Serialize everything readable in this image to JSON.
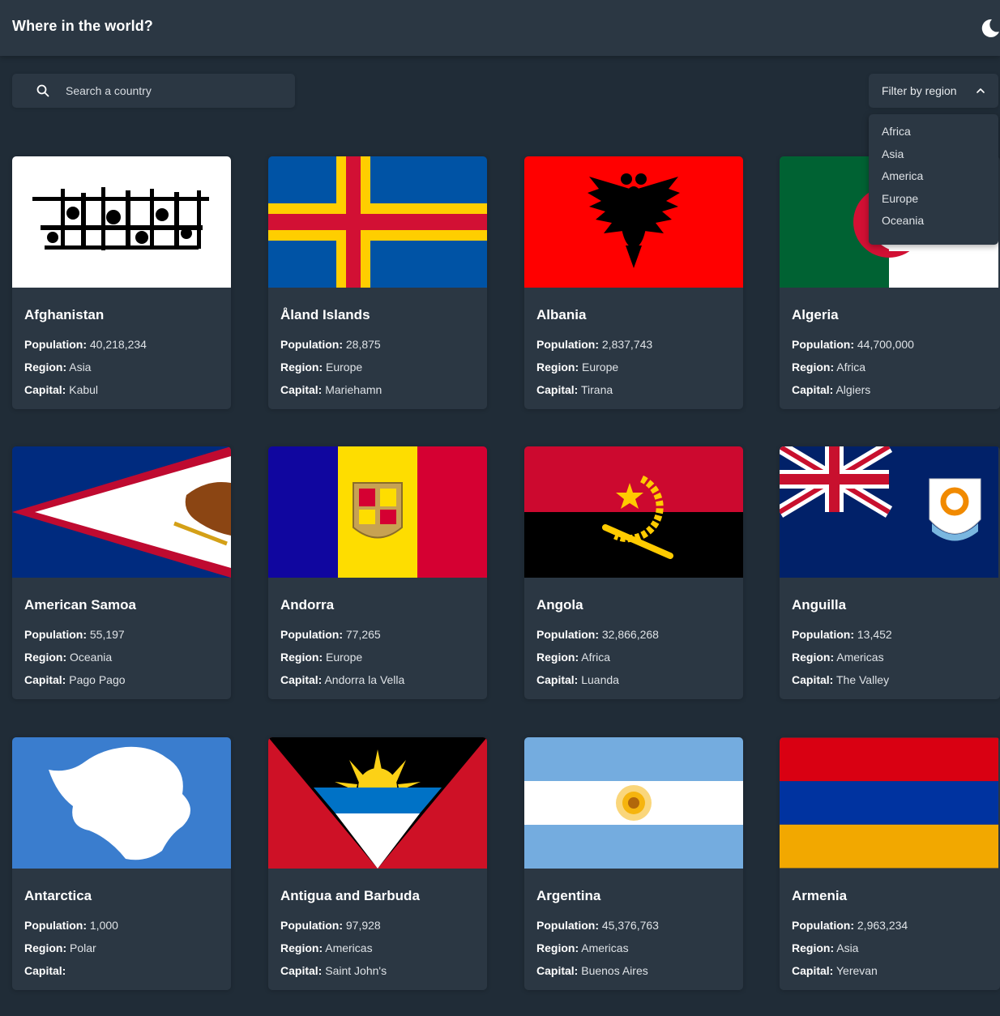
{
  "header": {
    "title": "Where in the world?",
    "theme_toggle_icon": "moon-icon"
  },
  "search": {
    "placeholder": "Search a country",
    "value": ""
  },
  "filter": {
    "label": "Filter by region",
    "expanded": true,
    "options": [
      "Africa",
      "Asia",
      "America",
      "Europe",
      "Oceania"
    ]
  },
  "labels": {
    "population": "Population:",
    "region": "Region:",
    "capital": "Capital:"
  },
  "countries": [
    {
      "name": "Afghanistan",
      "population": "40,218,234",
      "region": "Asia",
      "capital": "Kabul"
    },
    {
      "name": "Åland Islands",
      "population": "28,875",
      "region": "Europe",
      "capital": "Mariehamn"
    },
    {
      "name": "Albania",
      "population": "2,837,743",
      "region": "Europe",
      "capital": "Tirana"
    },
    {
      "name": "Algeria",
      "population": "44,700,000",
      "region": "Africa",
      "capital": "Algiers"
    },
    {
      "name": "American Samoa",
      "population": "55,197",
      "region": "Oceania",
      "capital": "Pago Pago"
    },
    {
      "name": "Andorra",
      "population": "77,265",
      "region": "Europe",
      "capital": "Andorra la Vella"
    },
    {
      "name": "Angola",
      "population": "32,866,268",
      "region": "Africa",
      "capital": "Luanda"
    },
    {
      "name": "Anguilla",
      "population": "13,452",
      "region": "Americas",
      "capital": "The Valley"
    },
    {
      "name": "Antarctica",
      "population": "1,000",
      "region": "Polar",
      "capital": ""
    },
    {
      "name": "Antigua and Barbuda",
      "population": "97,928",
      "region": "Americas",
      "capital": "Saint John's"
    },
    {
      "name": "Argentina",
      "population": "45,376,763",
      "region": "Americas",
      "capital": "Buenos Aires"
    },
    {
      "name": "Armenia",
      "population": "2,963,234",
      "region": "Asia",
      "capital": "Yerevan"
    }
  ],
  "colors": {
    "background": "#202c37",
    "element": "#2b3743",
    "text": "#ffffff"
  }
}
